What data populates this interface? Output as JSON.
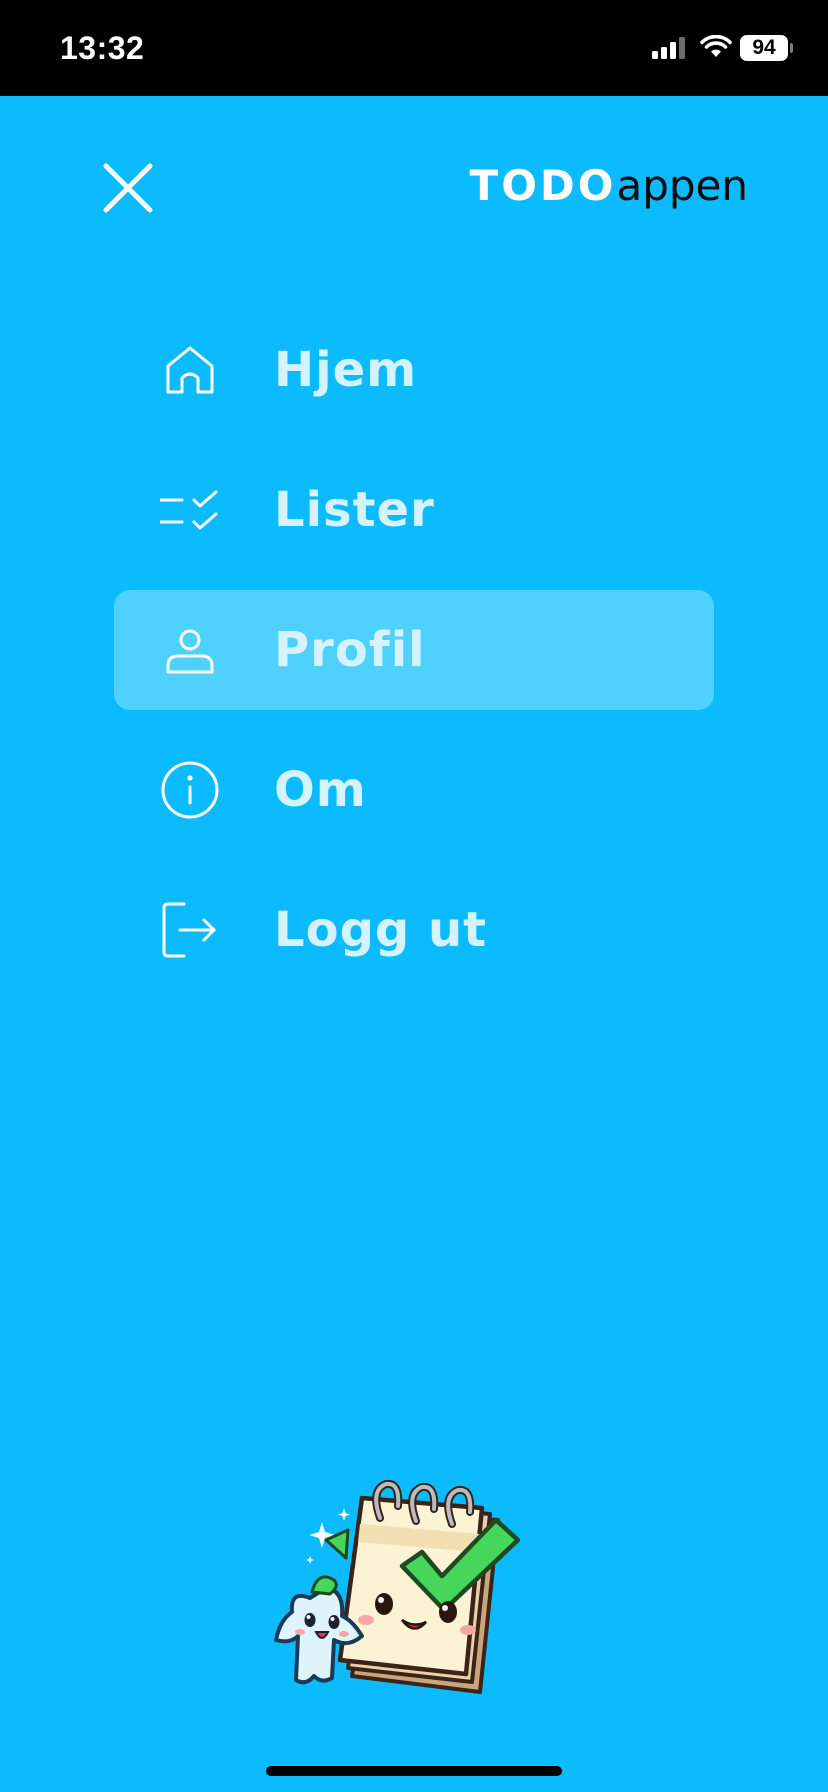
{
  "status_bar": {
    "time": "13:32",
    "battery": "94",
    "icons": [
      "signal-icon",
      "wifi-icon",
      "battery-icon"
    ]
  },
  "header": {
    "close_icon": "close-icon",
    "brand_bold": "TODO",
    "brand_light": "appen"
  },
  "menu": {
    "items": [
      {
        "label": "Hjem",
        "icon": "home-icon",
        "active": false
      },
      {
        "label": "Lister",
        "icon": "checklist-icon",
        "active": false
      },
      {
        "label": "Profil",
        "icon": "person-icon",
        "active": true
      },
      {
        "label": "Om",
        "icon": "info-icon",
        "active": false
      },
      {
        "label": "Logg ut",
        "icon": "logout-icon",
        "active": false
      }
    ]
  },
  "illustration": "notepad-mascot-illustration",
  "colors": {
    "background": "#0bbbfd",
    "active_item": "#4fd1fe",
    "menu_text": "#d5f2ff",
    "status_bar": "#000000"
  }
}
